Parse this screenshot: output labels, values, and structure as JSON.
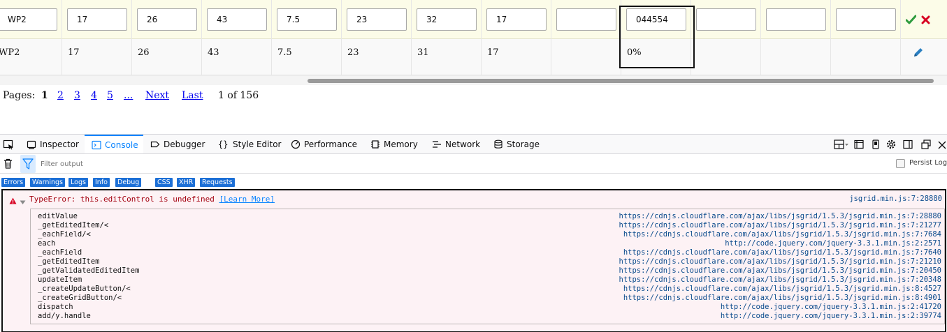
{
  "grid": {
    "edit_row": {
      "values": [
        "WP2",
        "17",
        "26",
        "43",
        "7.5",
        "23",
        "32",
        "17",
        "",
        "044554",
        "",
        "",
        ""
      ]
    },
    "view_row": {
      "values": [
        "WP2",
        "17",
        "26",
        "43",
        "7.5",
        "23",
        "31",
        "17",
        "",
        "0%",
        "",
        "",
        ""
      ]
    }
  },
  "pager": {
    "label": "Pages:",
    "current": "1",
    "pages": [
      "2",
      "3",
      "4",
      "5"
    ],
    "ellipsis": "...",
    "next": "Next",
    "last": "Last",
    "summary": "1 of 156"
  },
  "devtools": {
    "tabs": {
      "inspector": "Inspector",
      "console": "Console",
      "debugger": "Debugger",
      "style_editor": "Style Editor",
      "performance": "Performance",
      "memory": "Memory",
      "network": "Network",
      "storage": "Storage"
    },
    "filter": {
      "placeholder": "Filter output"
    },
    "persist_logs": "Persist Logs",
    "categories": [
      "Errors",
      "Warnings",
      "Logs",
      "Info",
      "Debug",
      "CSS",
      "XHR",
      "Requests"
    ],
    "error": {
      "message": "TypeError: this.editControl is undefined",
      "learn_more": "[Learn More]",
      "source": "jsgrid.min.js:7:28880",
      "stack": [
        {
          "fn": "editValue",
          "loc": "https://cdnjs.cloudflare.com/ajax/libs/jsgrid/1.5.3/jsgrid.min.js:7:28880"
        },
        {
          "fn": "_getEditedItem/<",
          "loc": "https://cdnjs.cloudflare.com/ajax/libs/jsgrid/1.5.3/jsgrid.min.js:7:21277"
        },
        {
          "fn": "_eachField/<",
          "loc": "https://cdnjs.cloudflare.com/ajax/libs/jsgrid/1.5.3/jsgrid.min.js:7:7684"
        },
        {
          "fn": "each",
          "loc": "http://code.jquery.com/jquery-3.3.1.min.js:2:2571"
        },
        {
          "fn": "_eachField",
          "loc": "https://cdnjs.cloudflare.com/ajax/libs/jsgrid/1.5.3/jsgrid.min.js:7:7640"
        },
        {
          "fn": "_getEditedItem",
          "loc": "https://cdnjs.cloudflare.com/ajax/libs/jsgrid/1.5.3/jsgrid.min.js:7:21210"
        },
        {
          "fn": "_getValidatedEditedItem",
          "loc": "https://cdnjs.cloudflare.com/ajax/libs/jsgrid/1.5.3/jsgrid.min.js:7:20450"
        },
        {
          "fn": "updateItem",
          "loc": "https://cdnjs.cloudflare.com/ajax/libs/jsgrid/1.5.3/jsgrid.min.js:7:20348"
        },
        {
          "fn": "_createUpdateButton/<",
          "loc": "https://cdnjs.cloudflare.com/ajax/libs/jsgrid/1.5.3/jsgrid.min.js:8:4527"
        },
        {
          "fn": "_createGridButton/<",
          "loc": "https://cdnjs.cloudflare.com/ajax/libs/jsgrid/1.5.3/jsgrid.min.js:8:4901"
        },
        {
          "fn": "dispatch",
          "loc": "http://code.jquery.com/jquery-3.3.1.min.js:2:41720"
        },
        {
          "fn": "add/y.handle",
          "loc": "http://code.jquery.com/jquery-3.3.1.min.js:2:39774"
        }
      ]
    }
  },
  "colors": {
    "accent": "#0a84ff",
    "error_text": "#a4000f",
    "error_bg": "#fdf2f5",
    "edit_row_bg": "#fcfce8",
    "link": "#0000ee",
    "update_icon": "#2e9b3e",
    "cancel_icon": "#d70022",
    "edit_icon": "#2a7fc1"
  },
  "icons": {
    "update": "checkmark-icon",
    "cancel": "close-icon",
    "edit": "pencil-icon"
  }
}
